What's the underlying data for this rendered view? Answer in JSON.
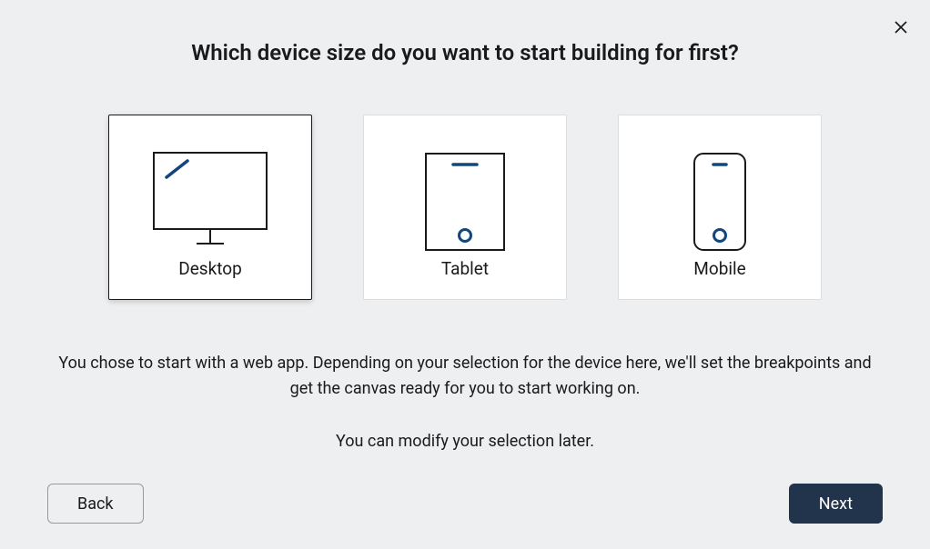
{
  "title": "Which device size do you want to start building for first?",
  "options": [
    {
      "label": "Desktop",
      "selected": true
    },
    {
      "label": "Tablet",
      "selected": false
    },
    {
      "label": "Mobile",
      "selected": false
    }
  ],
  "description_line1": "You chose to start with a web app. Depending on your selection for the device here, we'll set the breakpoints and get the canvas ready for you to start working on.",
  "description_line2": "You can modify your selection later.",
  "buttons": {
    "back": "Back",
    "next": "Next"
  },
  "colors": {
    "accent": "#12467d",
    "outline": "#1a1a1a",
    "primary_button_bg": "#21344b"
  }
}
